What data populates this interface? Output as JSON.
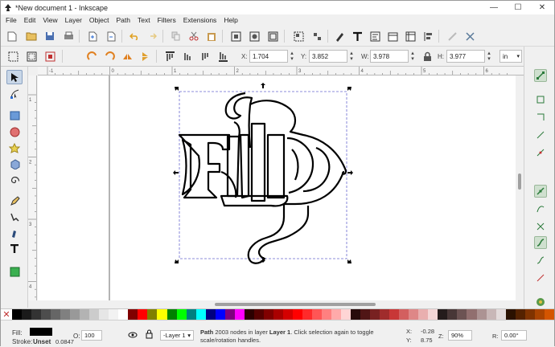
{
  "window": {
    "title": "*New document 1 - Inkscape",
    "minimize": "—",
    "maximize": "☐",
    "close": "✕"
  },
  "menu": [
    "File",
    "Edit",
    "View",
    "Layer",
    "Object",
    "Path",
    "Text",
    "Filters",
    "Extensions",
    "Help"
  ],
  "coords": {
    "x_label": "X:",
    "x_value": "1.704",
    "y_label": "Y:",
    "y_value": "3.852",
    "w_label": "W:",
    "w_value": "3.978",
    "h_label": "H:",
    "h_value": "3.977",
    "unit": "in"
  },
  "ruler": {
    "h_ticks": [
      "-1",
      "0",
      "1",
      "2",
      "3",
      "4",
      "5",
      "6"
    ],
    "v_ticks": [
      "1",
      "2",
      "3",
      "4",
      "5"
    ]
  },
  "status": {
    "fill_label": "Fill:",
    "stroke_label": "Stroke:",
    "stroke_value": "Unset",
    "stroke_width": "0.0847",
    "opacity_label": "O:",
    "opacity_value": "100",
    "layer": "-Layer 1",
    "message_bold1": "Path",
    "message_part1": " 2003 nodes in layer ",
    "message_bold2": "Layer 1",
    "message_part2": ". Click selection again to toggle scale/rotation handles.",
    "cursor_x_label": "X:",
    "cursor_x": "-0.28",
    "cursor_y_label": "Y:",
    "cursor_y": "8.75",
    "zoom_label": "Z:",
    "zoom": "90%",
    "rotation_label": "R:",
    "rotation": "0.00°"
  },
  "palette": [
    "#000000",
    "#1a1a1a",
    "#333333",
    "#4d4d4d",
    "#666666",
    "#808080",
    "#999999",
    "#b3b3b3",
    "#cccccc",
    "#e6e6e6",
    "#f2f2f2",
    "#ffffff",
    "#800000",
    "#ff0000",
    "#808000",
    "#ffff00",
    "#008000",
    "#00ff00",
    "#008080",
    "#00ffff",
    "#000080",
    "#0000ff",
    "#800080",
    "#ff00ff",
    "#2b0000",
    "#550000",
    "#800000",
    "#aa0000",
    "#d40000",
    "#ff0000",
    "#ff2a2a",
    "#ff5555",
    "#ff8080",
    "#ffaaaa",
    "#ffd5d5",
    "#280b0b",
    "#501616",
    "#782121",
    "#a02c2c",
    "#c83737",
    "#d35f5f",
    "#de8787",
    "#e9afaf",
    "#f4d7d7",
    "#241c1c",
    "#483737",
    "#6c5353",
    "#916f6f",
    "#ac9393",
    "#c8b7b7",
    "#e3dbdb",
    "#2b1100",
    "#552200",
    "#803300",
    "#aa4400",
    "#d45500"
  ]
}
